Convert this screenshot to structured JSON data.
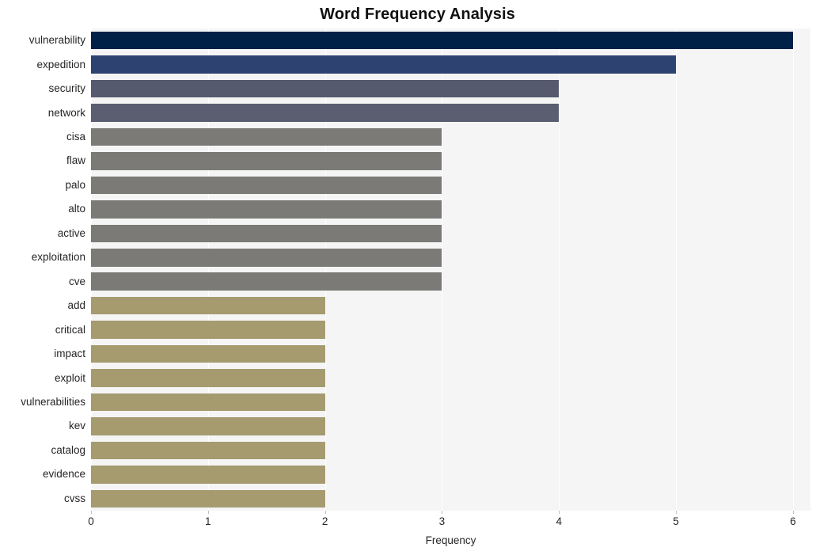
{
  "chart_data": {
    "type": "bar",
    "orientation": "horizontal",
    "title": "Word Frequency Analysis",
    "xlabel": "Frequency",
    "ylabel": "",
    "xlim": [
      0,
      6.15
    ],
    "xticks": [
      0,
      1,
      2,
      3,
      4,
      5,
      6
    ],
    "xtick_labels": [
      "0",
      "1",
      "2",
      "3",
      "4",
      "5",
      "6"
    ],
    "grid": true,
    "grid_axis": "x",
    "legend": false,
    "categories": [
      "vulnerability",
      "expedition",
      "security",
      "network",
      "cisa",
      "flaw",
      "palo",
      "alto",
      "active",
      "exploitation",
      "cve",
      "add",
      "critical",
      "impact",
      "exploit",
      "vulnerabilities",
      "kev",
      "catalog",
      "evidence",
      "cvss"
    ],
    "values": [
      6,
      5,
      4,
      4,
      3,
      3,
      3,
      3,
      3,
      3,
      3,
      2,
      2,
      2,
      2,
      2,
      2,
      2,
      2,
      2
    ],
    "bar_colors": [
      "#002147",
      "#2e4272",
      "#565a6e",
      "#5a5e70",
      "#7b7a77",
      "#7b7a77",
      "#7b7a77",
      "#7b7a77",
      "#7b7a77",
      "#7b7a77",
      "#7b7a77",
      "#a59b6f",
      "#a59b6f",
      "#a59b6f",
      "#a59b6f",
      "#a59b6f",
      "#a59b6f",
      "#a59b6f",
      "#a59b6f",
      "#a59b6f"
    ]
  },
  "style": {
    "plot_background": "#f5f5f5",
    "gridline_color": "#ffffff",
    "figure_background": "#ffffff",
    "text_color": "#262626",
    "title_color": "#111111"
  }
}
